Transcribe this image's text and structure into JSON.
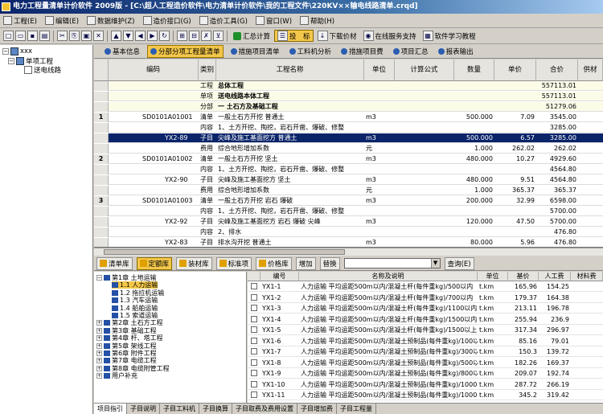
{
  "window": {
    "title": "电力工程量清单计价软件 2009版 - [C:\\超人工程造价软件\\电力清单计价软件\\我的工程文件\\220KV××输电线路清单.crqd]"
  },
  "menu": [
    {
      "label": "工程(E)",
      "icon": "project-icon"
    },
    {
      "label": "编辑(E)",
      "icon": "edit-icon"
    },
    {
      "label": "数据维护(Z)",
      "icon": "data-maintenance-icon"
    },
    {
      "label": "造价接口(G)",
      "icon": "interface-icon"
    },
    {
      "label": "造价工具(G)",
      "icon": "tools-icon"
    },
    {
      "label": "窗口(W)",
      "icon": "window-icon"
    },
    {
      "label": "帮助(H)",
      "icon": "help-icon"
    }
  ],
  "toolbar": {
    "summary_label": "汇总计算",
    "bid_label": "投　标",
    "download_label": "下载价材",
    "online_label": "在线服务支持",
    "tutorial_label": "软件学习教程"
  },
  "sidebar": {
    "root": "xxx",
    "child": "单项工程",
    "leaf": "送电线路"
  },
  "tabs": [
    {
      "label": "基本信息",
      "active": false
    },
    {
      "label": "分部分项工程量清单",
      "active": true
    },
    {
      "label": "措施项目清单",
      "active": false
    },
    {
      "label": "工料机分析",
      "active": false
    },
    {
      "label": "措施项目费",
      "active": false
    },
    {
      "label": "项目汇总",
      "active": false
    },
    {
      "label": "报表输出",
      "active": false
    }
  ],
  "main_table": {
    "columns": [
      "编码",
      "类别",
      "工程名称",
      "单位",
      "计算公式",
      "数量",
      "单价",
      "合价",
      "供材"
    ],
    "rows": [
      {
        "num": "",
        "code": "",
        "type": "工程",
        "name": "总体工程",
        "unit": "",
        "formula": "",
        "qty": "",
        "price": "",
        "total": "557113.01",
        "bold": true,
        "section": true
      },
      {
        "num": "",
        "code": "",
        "type": "单项",
        "name": "送电线路本体工程",
        "unit": "",
        "formula": "",
        "qty": "",
        "price": "",
        "total": "557113.01",
        "bold": true,
        "section": true
      },
      {
        "num": "",
        "code": "",
        "type": "分部",
        "name": "一 土石方及基础工程",
        "unit": "",
        "formula": "",
        "qty": "",
        "price": "",
        "total": "51279.06",
        "bold": true,
        "section": true
      },
      {
        "num": "1",
        "code": "SD0101A01001",
        "type": "清单",
        "name": "一般土石方开挖 普通土",
        "unit": "m3",
        "formula": "",
        "qty": "500.000",
        "price": "7.09",
        "total": "3545.00"
      },
      {
        "num": "",
        "code": "",
        "type": "内容",
        "name": "1、土方开挖、掏挖，岩石开凿、爆破、修整",
        "unit": "",
        "formula": "",
        "qty": "",
        "price": "",
        "total": "3285.00"
      },
      {
        "num": "",
        "code": "YX2-89",
        "type": "子目",
        "name": "尖峰及施工基面挖方 普通土",
        "unit": "m3",
        "formula": "",
        "qty": "500.000",
        "price": "6.57",
        "total": "3285.00",
        "selected": true
      },
      {
        "num": "",
        "code": "",
        "type": "费用",
        "name": "综合地形增加系数",
        "unit": "元",
        "formula": "",
        "qty": "1.000",
        "price": "262.02",
        "total": "262.02"
      },
      {
        "num": "2",
        "code": "SD0101A01002",
        "type": "清单",
        "name": "一般土石方开挖 坚土",
        "unit": "m3",
        "formula": "",
        "qty": "480.000",
        "price": "10.27",
        "total": "4929.60"
      },
      {
        "num": "",
        "code": "",
        "type": "内容",
        "name": "1、土方开挖、掏挖，岩石开凿、爆破、修整",
        "unit": "",
        "formula": "",
        "qty": "",
        "price": "",
        "total": "4564.80"
      },
      {
        "num": "",
        "code": "YX2-90",
        "type": "子目",
        "name": "尖峰及施工基面挖方 坚土",
        "unit": "m3",
        "formula": "",
        "qty": "480.000",
        "price": "9.51",
        "total": "4564.80"
      },
      {
        "num": "",
        "code": "",
        "type": "费用",
        "name": "综合地形增加系数",
        "unit": "元",
        "formula": "",
        "qty": "1.000",
        "price": "365.37",
        "total": "365.37"
      },
      {
        "num": "3",
        "code": "SD0101A01003",
        "type": "清单",
        "name": "一般土石方开挖 岩石 爆破",
        "unit": "m3",
        "formula": "",
        "qty": "200.000",
        "price": "32.99",
        "total": "6598.00"
      },
      {
        "num": "",
        "code": "",
        "type": "内容",
        "name": "1、土方开挖、掏挖，岩石开凿、爆破、修整",
        "unit": "",
        "formula": "",
        "qty": "",
        "price": "",
        "total": "5700.00"
      },
      {
        "num": "",
        "code": "YX2-92",
        "type": "子目",
        "name": "尖峰及施工基面挖方 岩石 爆破 尖峰",
        "unit": "m3",
        "formula": "",
        "qty": "120.000",
        "price": "47.50",
        "total": "5700.00"
      },
      {
        "num": "",
        "code": "",
        "type": "内容",
        "name": "2、排水",
        "unit": "",
        "formula": "",
        "qty": "",
        "price": "",
        "total": "476.80"
      },
      {
        "num": "",
        "code": "YX2-83",
        "type": "子目",
        "name": "排水沟开挖 普通土",
        "unit": "m3",
        "formula": "",
        "qty": "80.000",
        "price": "5.96",
        "total": "476.80"
      }
    ]
  },
  "library_bar": {
    "list_lib": "清单库",
    "quota_lib": "定额库",
    "material_lib": "装材库",
    "standard_item": "标准项",
    "price_lib": "价格库",
    "add_label": "增加",
    "replace_label": "替换",
    "combo_value": "",
    "query_label": "查询(E)"
  },
  "library_tree": [
    {
      "label": "第1章 土地运输",
      "level": 0,
      "expanded": true
    },
    {
      "label": "1.1 人力运输",
      "level": 1,
      "highlight": true
    },
    {
      "label": "1.2 拖拉机运输",
      "level": 1
    },
    {
      "label": "1.3 汽车运输",
      "level": 1
    },
    {
      "label": "1.4 船舶运输",
      "level": 1
    },
    {
      "label": "1.5 索道运输",
      "level": 1
    },
    {
      "label": "第2章 土石方工程",
      "level": 0
    },
    {
      "label": "第3章 基础工程",
      "level": 0
    },
    {
      "label": "第4章 杆、塔工程",
      "level": 0
    },
    {
      "label": "第5章 架线工程",
      "level": 0
    },
    {
      "label": "第6章 附件工程",
      "level": 0
    },
    {
      "label": "第7章 电缆工程",
      "level": 0
    },
    {
      "label": "第8章 电缆附管工程",
      "level": 0
    },
    {
      "label": "用户补充",
      "level": 0
    }
  ],
  "library_table": {
    "columns": [
      "编号",
      "名称及说明",
      "单位",
      "基价",
      "人工费",
      "材料费"
    ],
    "rows": [
      {
        "code": "YX1-1",
        "name": "人力运输 平均运距500m以内/混凝土杆(每件重kg)/500以内",
        "unit": "t.km",
        "base": "165.96",
        "labor": "154.25"
      },
      {
        "code": "YX1-2",
        "name": "人力运输 平均运距500m以内/混凝土杆(每件重kg)/700以内",
        "unit": "t.km",
        "base": "179.37",
        "labor": "164.38"
      },
      {
        "code": "YX1-3",
        "name": "人力运输 平均运距500m以内/混凝土杆(每件重kg)/1100以内",
        "unit": "t.km",
        "base": "213.11",
        "labor": "196.78"
      },
      {
        "code": "YX1-4",
        "name": "人力运输 平均运距500m以内/混凝土杆(每件重kg)/1500以内",
        "unit": "t.km",
        "base": "255.94",
        "labor": "236.9"
      },
      {
        "code": "YX1-5",
        "name": "人力运输 平均运距500m以内/混凝土杆(每件重kg)/1500以上",
        "unit": "t.km",
        "base": "317.34",
        "labor": "296.97"
      },
      {
        "code": "YX1-6",
        "name": "人力运输 平均运距500m以内/混凝土预制品(每件重kg)/100以内",
        "unit": "t.km",
        "base": "85.16",
        "labor": "79.01"
      },
      {
        "code": "YX1-7",
        "name": "人力运输 平均运距500m以内/混凝土预制品(每件重kg)/300以内",
        "unit": "t.km",
        "base": "150.3",
        "labor": "139.72"
      },
      {
        "code": "YX1-8",
        "name": "人力运输 平均运距500m以内/混凝土预制品(每件重kg)/500以内",
        "unit": "t.km",
        "base": "182.26",
        "labor": "169.37"
      },
      {
        "code": "YX1-9",
        "name": "人力运输 平均运距500m以内/混凝土预制品(每件重kg)/800以内",
        "unit": "t.km",
        "base": "209.07",
        "labor": "192.74"
      },
      {
        "code": "YX1-10",
        "name": "人力运输 平均运距500m以内/混凝土预制品(每件重kg)/1000以内",
        "unit": "t.km",
        "base": "287.72",
        "labor": "266.19"
      },
      {
        "code": "YX1-11",
        "name": "人力运输 平均运距500m以内/混凝土预制品(每件重kg)/1000以上",
        "unit": "t.km",
        "base": "345.2",
        "labor": "319.42"
      }
    ]
  },
  "bottom_tabs": [
    "项目指引",
    "子目说明",
    "子目工料机",
    "子目换算",
    "子目取费及费用设置",
    "子目增加费",
    "子目工程量"
  ]
}
